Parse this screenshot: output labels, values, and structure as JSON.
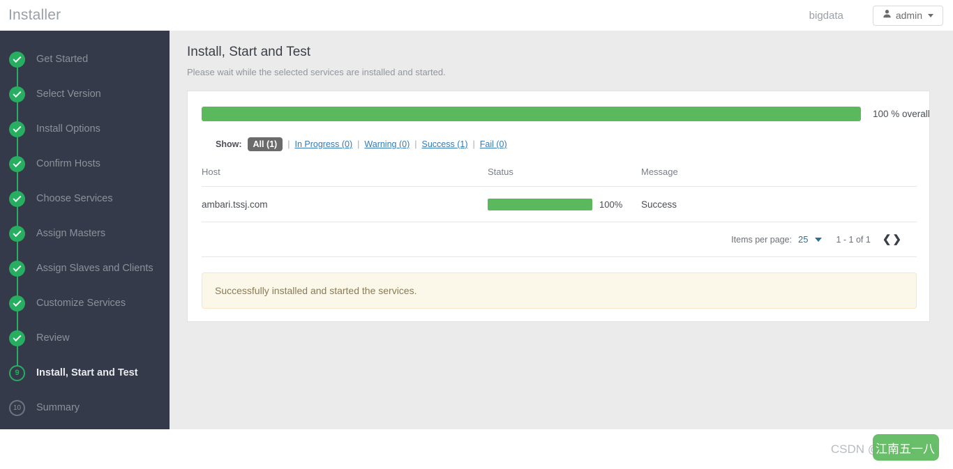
{
  "topbar": {
    "brand": "Installer",
    "cluster_name": "bigdata",
    "user_label": "admin",
    "user_icon": "user-icon",
    "caret_icon": "caret-down-icon"
  },
  "sidebar": {
    "steps": [
      {
        "label": "Get Started",
        "state": "done",
        "marker": "check"
      },
      {
        "label": "Select Version",
        "state": "done",
        "marker": "check"
      },
      {
        "label": "Install Options",
        "state": "done",
        "marker": "check"
      },
      {
        "label": "Confirm Hosts",
        "state": "done",
        "marker": "check"
      },
      {
        "label": "Choose Services",
        "state": "done",
        "marker": "check"
      },
      {
        "label": "Assign Masters",
        "state": "done",
        "marker": "check"
      },
      {
        "label": "Assign Slaves and Clients",
        "state": "done",
        "marker": "check"
      },
      {
        "label": "Customize Services",
        "state": "done",
        "marker": "check"
      },
      {
        "label": "Review",
        "state": "done",
        "marker": "check"
      },
      {
        "label": "Install, Start and Test",
        "state": "current",
        "marker": "9"
      },
      {
        "label": "Summary",
        "state": "pending",
        "marker": "10"
      }
    ]
  },
  "main": {
    "title": "Install, Start and Test",
    "subtitle": "Please wait while the selected services are installed and started.",
    "overall": {
      "percent": 100,
      "label": "100 % overall"
    },
    "filters": {
      "show_word": "Show:",
      "separator": "|",
      "items": [
        {
          "label": "All (1)",
          "active": true
        },
        {
          "label": "In Progress (0)",
          "active": false
        },
        {
          "label": "Warning (0)",
          "active": false
        },
        {
          "label": "Success (1)",
          "active": false
        },
        {
          "label": "Fail (0)",
          "active": false
        }
      ]
    },
    "table": {
      "columns": [
        "Host",
        "Status",
        "Message"
      ],
      "rows": [
        {
          "host": "ambari.tssj.com",
          "status_percent": 100,
          "status_label": "100%",
          "message": "Success"
        }
      ]
    },
    "pagination": {
      "items_per_page_label": "Items per page:",
      "items_per_page_value": "25",
      "range": "1 - 1 of 1",
      "prev_icon": "chevron-left-icon",
      "next_icon": "chevron-right-icon",
      "prev_glyph": "❮",
      "next_glyph": "❯"
    },
    "alert": {
      "text": "Successfully installed and started the services."
    }
  },
  "watermark": {
    "text": "CSDN @江南五一八",
    "chip_text": "江南五一八"
  },
  "colors": {
    "sidebar_bg": "#343a4a",
    "page_bg": "#ebebeb",
    "progress_green": "#5cb85c",
    "step_green": "#27ae60",
    "link_blue": "#337ab7",
    "alert_bg": "#fcf8e9",
    "alert_border": "#f6e6c3"
  }
}
